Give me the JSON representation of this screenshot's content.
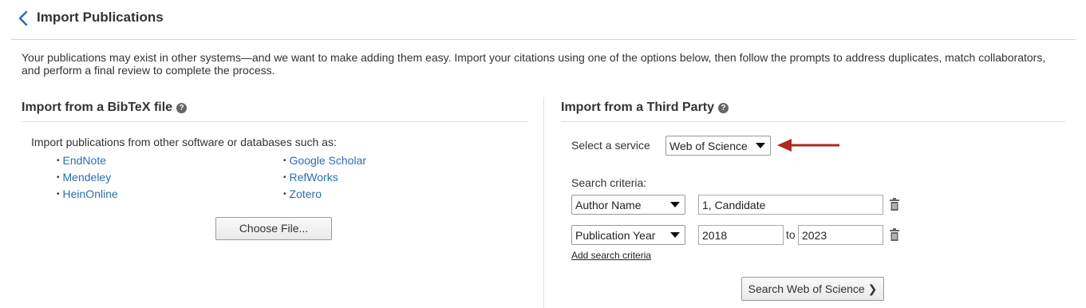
{
  "header": {
    "title": "Import Publications"
  },
  "intro_text": "Your publications may exist in other systems—and we want to make adding them easy. Import your citations using one of the options below, then follow the prompts to address duplicates, match collaborators, and perform a final review to complete the process.",
  "bibtex": {
    "title": "Import from a BibTeX file",
    "lead": "Import publications from other software or databases such as:",
    "sources_left": [
      "EndNote",
      "Mendeley",
      "HeinOnline"
    ],
    "sources_right": [
      "Google Scholar",
      "RefWorks",
      "Zotero"
    ],
    "choose_file_label": "Choose File..."
  },
  "third_party": {
    "title": "Import from a Third Party",
    "service_label": "Select a service",
    "service_value": "Web of Science",
    "criteria_label": "Search criteria:",
    "criteria": [
      {
        "field": "Author Name",
        "value": "1, Candidate"
      },
      {
        "field": "Publication Year",
        "from": "2018",
        "to_label": "to",
        "to": "2023"
      }
    ],
    "add_criteria_label": "Add search criteria",
    "search_button_label": "Search Web of Science ❯"
  },
  "colors": {
    "link": "#2a6fb0",
    "arrow": "#b0281c",
    "rule": "#d5d5d5"
  },
  "icons": {
    "back": "chevron-left-icon",
    "help": "question-circle-icon",
    "delete": "trash-icon",
    "pointer": "arrow-left-annotation"
  }
}
